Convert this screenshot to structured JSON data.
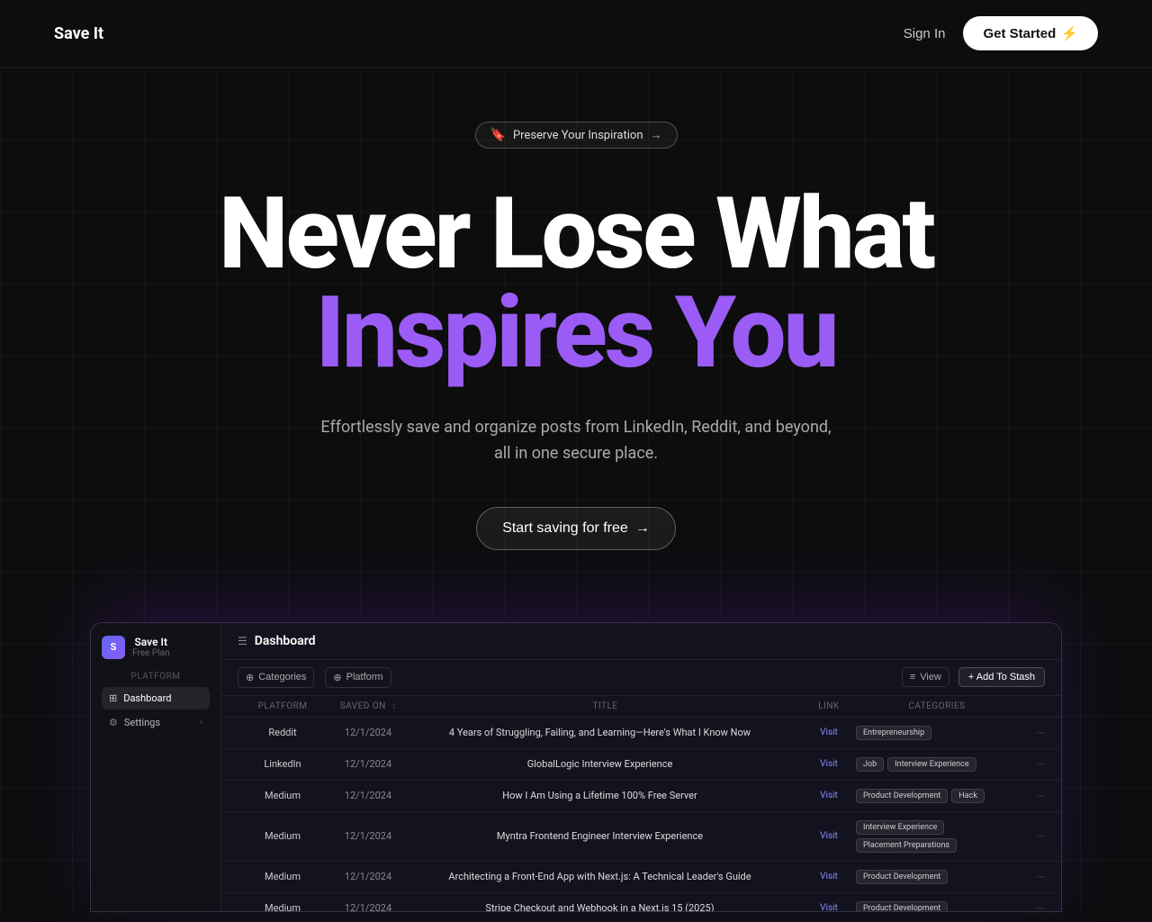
{
  "nav": {
    "logo": "Save It",
    "sign_in": "Sign In",
    "get_started": "Get Started",
    "get_started_icon": "⚡"
  },
  "hero": {
    "badge_icon": "🔖",
    "badge_text": "Preserve Your Inspiration",
    "badge_arrow": "→",
    "heading_line1": "Never Lose What",
    "heading_line2": "Inspires You",
    "subtext_line1": "Effortlessly save and organize posts from LinkedIn, Reddit, and beyond,",
    "subtext_line2": "all in one secure place.",
    "cta_text": "Start saving for free",
    "cta_arrow": "→"
  },
  "dashboard": {
    "sidebar": {
      "brand_initial": "S",
      "brand_name": "Save It",
      "plan": "Free Plan",
      "section_label": "Platform",
      "items": [
        {
          "icon": "⊞",
          "label": "Dashboard",
          "active": true
        },
        {
          "icon": "⚙",
          "label": "Settings",
          "active": false,
          "has_arrow": true
        }
      ]
    },
    "header": {
      "icon": "☰",
      "title": "Dashboard"
    },
    "toolbar": {
      "categories_btn": "Categories",
      "platform_btn": "Platform",
      "view_btn": "View",
      "add_stash_btn": "+ Add To Stash"
    },
    "table": {
      "columns": [
        "Platform",
        "Saved On",
        "Title",
        "Link",
        "Categories",
        ""
      ],
      "rows": [
        {
          "platform": "Reddit",
          "date": "12/1/2024",
          "title": "4 Years of Struggling, Failing, and Learning—Here's What I Know Now",
          "link": "Visit",
          "categories": [
            "Entrepreneurship"
          ],
          "menu": "···"
        },
        {
          "platform": "LinkedIn",
          "date": "12/1/2024",
          "title": "GlobalLogic Interview Experience",
          "link": "Visit",
          "categories": [
            "Job",
            "Interview Experience"
          ],
          "menu": "···"
        },
        {
          "platform": "Medium",
          "date": "12/1/2024",
          "title": "How I Am Using a Lifetime 100% Free Server",
          "link": "Visit",
          "categories": [
            "Product Development",
            "Hack"
          ],
          "menu": "···"
        },
        {
          "platform": "Medium",
          "date": "12/1/2024",
          "title": "Myntra Frontend Engineer Interview Experience",
          "link": "Visit",
          "categories": [
            "Interview Experience",
            "Placement Preparations"
          ],
          "menu": "···"
        },
        {
          "platform": "Medium",
          "date": "12/1/2024",
          "title": "Architecting a Front-End App with Next.js: A Technical Leader's Guide",
          "link": "Visit",
          "categories": [
            "Product Development"
          ],
          "menu": "···"
        },
        {
          "platform": "Medium",
          "date": "12/1/2024",
          "title": "Stripe Checkout and Webhook in a Next.js 15 (2025)",
          "link": "Visit",
          "categories": [
            "Product Development"
          ],
          "menu": "···"
        }
      ]
    }
  }
}
